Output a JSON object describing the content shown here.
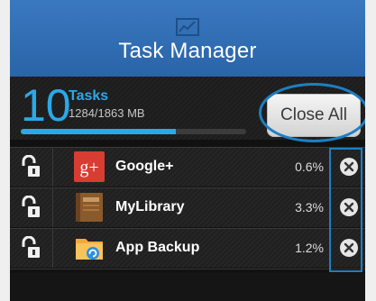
{
  "header": {
    "title": "Task Manager",
    "icon": "chart-icon"
  },
  "summary": {
    "count": "10",
    "count_label": "Tasks",
    "memory": "1284/1863 MB",
    "memory_used_fraction": 0.689,
    "accent_color": "#2aa9e8"
  },
  "actions": {
    "close_all_label": "Close All"
  },
  "tasks": [
    {
      "name": "Google+",
      "usage": "0.6%",
      "icon": "google-plus-icon"
    },
    {
      "name": "MyLibrary",
      "usage": "3.3%",
      "icon": "book-icon"
    },
    {
      "name": "App Backup",
      "usage": "1.2%",
      "icon": "backup-folder-icon"
    }
  ],
  "annotation_color": "#1d7fc1"
}
